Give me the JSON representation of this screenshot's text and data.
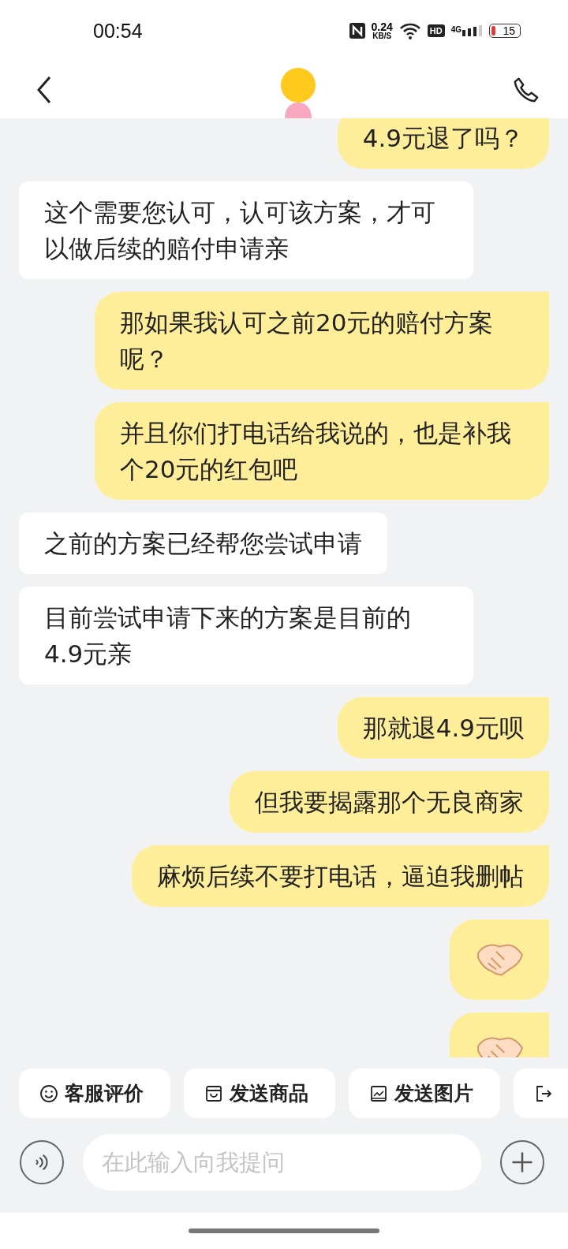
{
  "status_bar": {
    "time": "00:54",
    "net_speed": "0.24",
    "net_unit": "KB/S",
    "hd": "HD",
    "network": "4G",
    "battery": "15"
  },
  "messages": [
    {
      "outgoing": true,
      "kind": "text",
      "text": "4.9元退了吗？"
    },
    {
      "outgoing": false,
      "kind": "text",
      "text": "这个需要您认可，认可该方案，才可以做后续的赔付申请亲"
    },
    {
      "outgoing": true,
      "kind": "text",
      "text": "那如果我认可之前20元的赔付方案呢？"
    },
    {
      "outgoing": true,
      "kind": "text",
      "text": "并且你们打电话给我说的，也是补我个20元的红包吧"
    },
    {
      "outgoing": false,
      "kind": "text",
      "text": "之前的方案已经帮您尝试申请"
    },
    {
      "outgoing": false,
      "kind": "text",
      "text": "目前尝试申请下来的方案是目前的4.9元亲"
    },
    {
      "outgoing": true,
      "kind": "text",
      "text": "那就退4.9元呗"
    },
    {
      "outgoing": true,
      "kind": "text",
      "text": "但我要揭露那个无良商家"
    },
    {
      "outgoing": true,
      "kind": "text",
      "text": "麻烦后续不要打电话，逼迫我删帖"
    },
    {
      "outgoing": true,
      "kind": "sticker"
    },
    {
      "outgoing": true,
      "kind": "sticker"
    }
  ],
  "quick_actions": [
    {
      "kind": "rating",
      "label": "客服评价"
    },
    {
      "kind": "product",
      "label": "发送商品"
    },
    {
      "kind": "photo",
      "label": "发送图片"
    },
    {
      "kind": "exit"
    }
  ],
  "input": {
    "placeholder": "在此输入向我提问"
  }
}
